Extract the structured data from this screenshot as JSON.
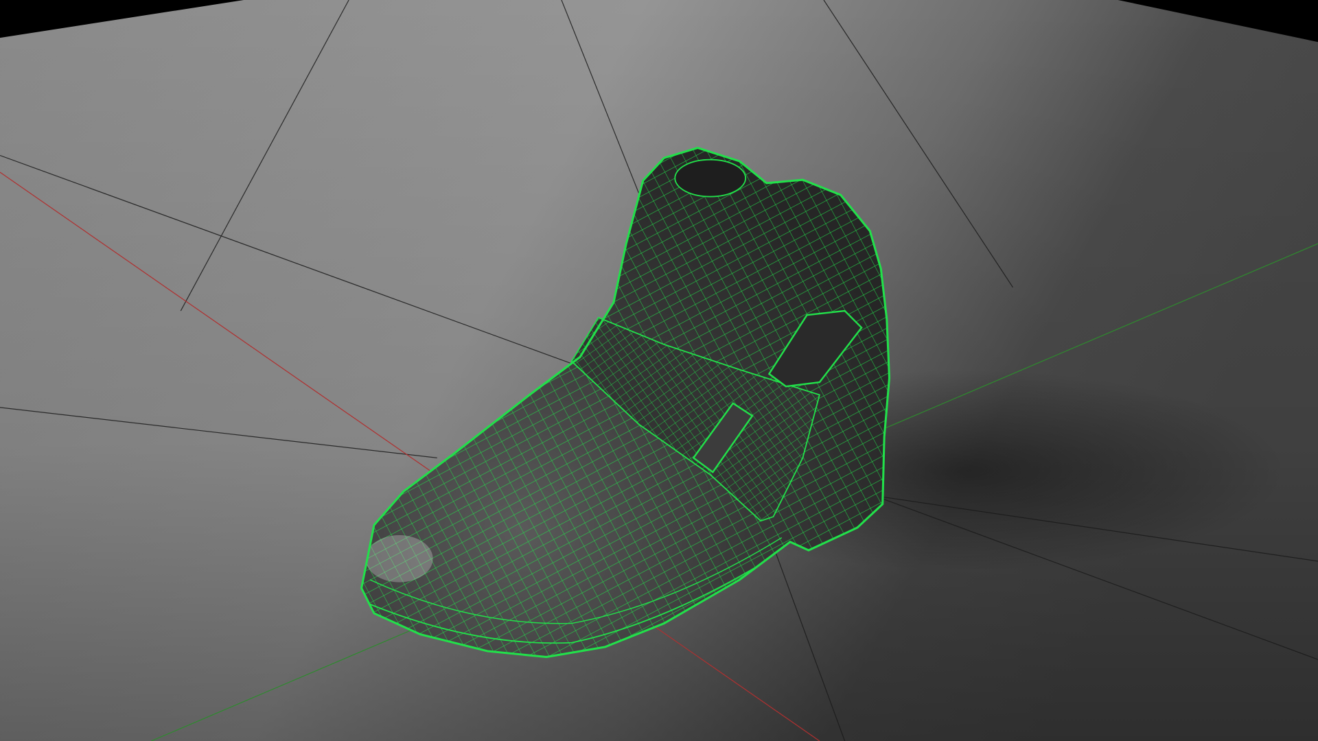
{
  "viewport": {
    "colors": {
      "floor_light": "#9a9a9a",
      "floor_dark": "#4a4a4a",
      "grid_line": "#1a1a1a",
      "x_axis": "#b03030",
      "y_axis": "#2e8a2e",
      "wireframe": "#22e04a",
      "mesh_fill": "#2e2e2e"
    }
  }
}
